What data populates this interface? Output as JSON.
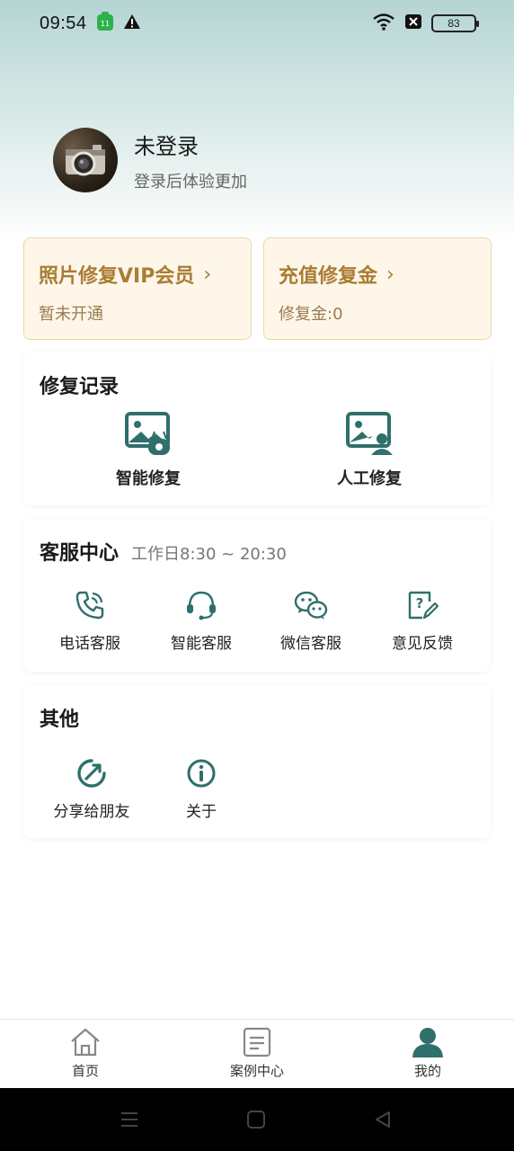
{
  "status_bar": {
    "time": "09:54",
    "battery": "83"
  },
  "profile": {
    "name": "未登录",
    "subtitle": "登录后体验更加"
  },
  "vip_cards": [
    {
      "title": "照片修复VIP会员",
      "subtitle": "暂未开通"
    },
    {
      "title": "充值修复金",
      "subtitle": "修复金:0"
    }
  ],
  "repair_records": {
    "title": "修复记录",
    "items": [
      {
        "label": "智能修复",
        "icon": "smart-repair-icon"
      },
      {
        "label": "人工修复",
        "icon": "manual-repair-icon"
      }
    ]
  },
  "customer_service": {
    "title": "客服中心",
    "hours": "工作日8:30 ~ 20:30",
    "items": [
      {
        "label": "电话客服",
        "icon": "phone-icon"
      },
      {
        "label": "智能客服",
        "icon": "headset-icon"
      },
      {
        "label": "微信客服",
        "icon": "wechat-icon"
      },
      {
        "label": "意见反馈",
        "icon": "feedback-icon"
      }
    ]
  },
  "other": {
    "title": "其他",
    "items": [
      {
        "label": "分享给朋友",
        "icon": "share-icon"
      },
      {
        "label": "关于",
        "icon": "info-icon"
      }
    ]
  },
  "bottom_nav": [
    {
      "label": "首页",
      "icon": "home-icon",
      "active": false
    },
    {
      "label": "案例中心",
      "icon": "document-icon",
      "active": false
    },
    {
      "label": "我的",
      "icon": "user-icon",
      "active": true
    }
  ],
  "colors": {
    "accent": "#2f6f6c",
    "gold": "#a97d34",
    "vip_bg": "#fdf6e9"
  }
}
